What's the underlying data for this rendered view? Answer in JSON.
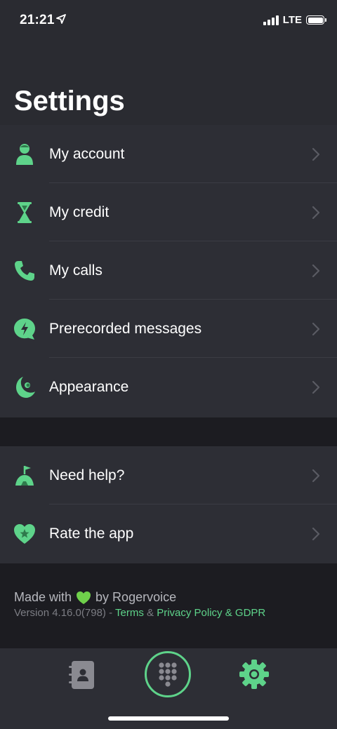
{
  "status": {
    "time": "21:21",
    "network": "LTE"
  },
  "page_title": "Settings",
  "menu_group_1": [
    {
      "label": "My account",
      "icon": "person-icon"
    },
    {
      "label": "My credit",
      "icon": "hourglass-icon"
    },
    {
      "label": "My calls",
      "icon": "phone-icon"
    },
    {
      "label": "Prerecorded messages",
      "icon": "lightning-bubble-icon"
    },
    {
      "label": "Appearance",
      "icon": "moon-icon"
    }
  ],
  "menu_group_2": [
    {
      "label": "Need help?",
      "icon": "help-flag-icon"
    },
    {
      "label": "Rate the app",
      "icon": "heart-star-icon"
    }
  ],
  "footer": {
    "made_with": "Made with",
    "made_by": "by Rogervoice",
    "version": "Version 4.16.0(798)",
    "separator": "-",
    "terms": "Terms",
    "ampersand": "&",
    "privacy": "Privacy Policy & GDPR"
  },
  "tab_bar": [
    "contacts-icon",
    "dialpad-icon",
    "settings-gear-icon"
  ],
  "colors": {
    "accent": "#5ed38a",
    "background": "#1c1c21",
    "row_background": "#2d2e35"
  }
}
